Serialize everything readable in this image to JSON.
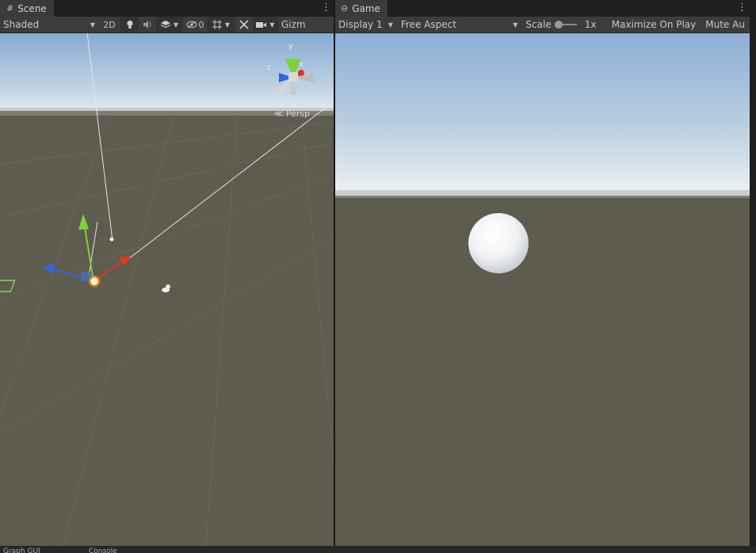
{
  "scene": {
    "tab_label": "Scene",
    "tab_icon": "#",
    "menu_icon": "⋮",
    "shading_mode": "Shaded",
    "toolbar": {
      "mode_2d_label": "2D",
      "hidden_count": "0",
      "gizmos_label": "Gizm"
    },
    "orientation_gizmo": {
      "y_label": "y",
      "x_label": "x",
      "z_label": "z"
    },
    "projection_label": "Persp"
  },
  "game": {
    "tab_label": "Game",
    "tab_icon": "⊖",
    "menu_icon": "⋮",
    "display": "Display 1",
    "aspect": "Free Aspect",
    "scale_label": "Scale",
    "scale_value": "1x",
    "maximize_label": "Maximize On Play",
    "mute_label": "Mute Au"
  },
  "bottom": {
    "tab1_label": "Graph GUI",
    "tab2_label": "Console"
  },
  "colors": {
    "sky_top": "#8eb1d9",
    "horizon": "#d7e4ea",
    "ground": "#5e5b4f",
    "axis_x": "#d63a22",
    "axis_y": "#7fd13a",
    "axis_z": "#3465d8",
    "panel_toolbar": "#3c3c3c"
  }
}
